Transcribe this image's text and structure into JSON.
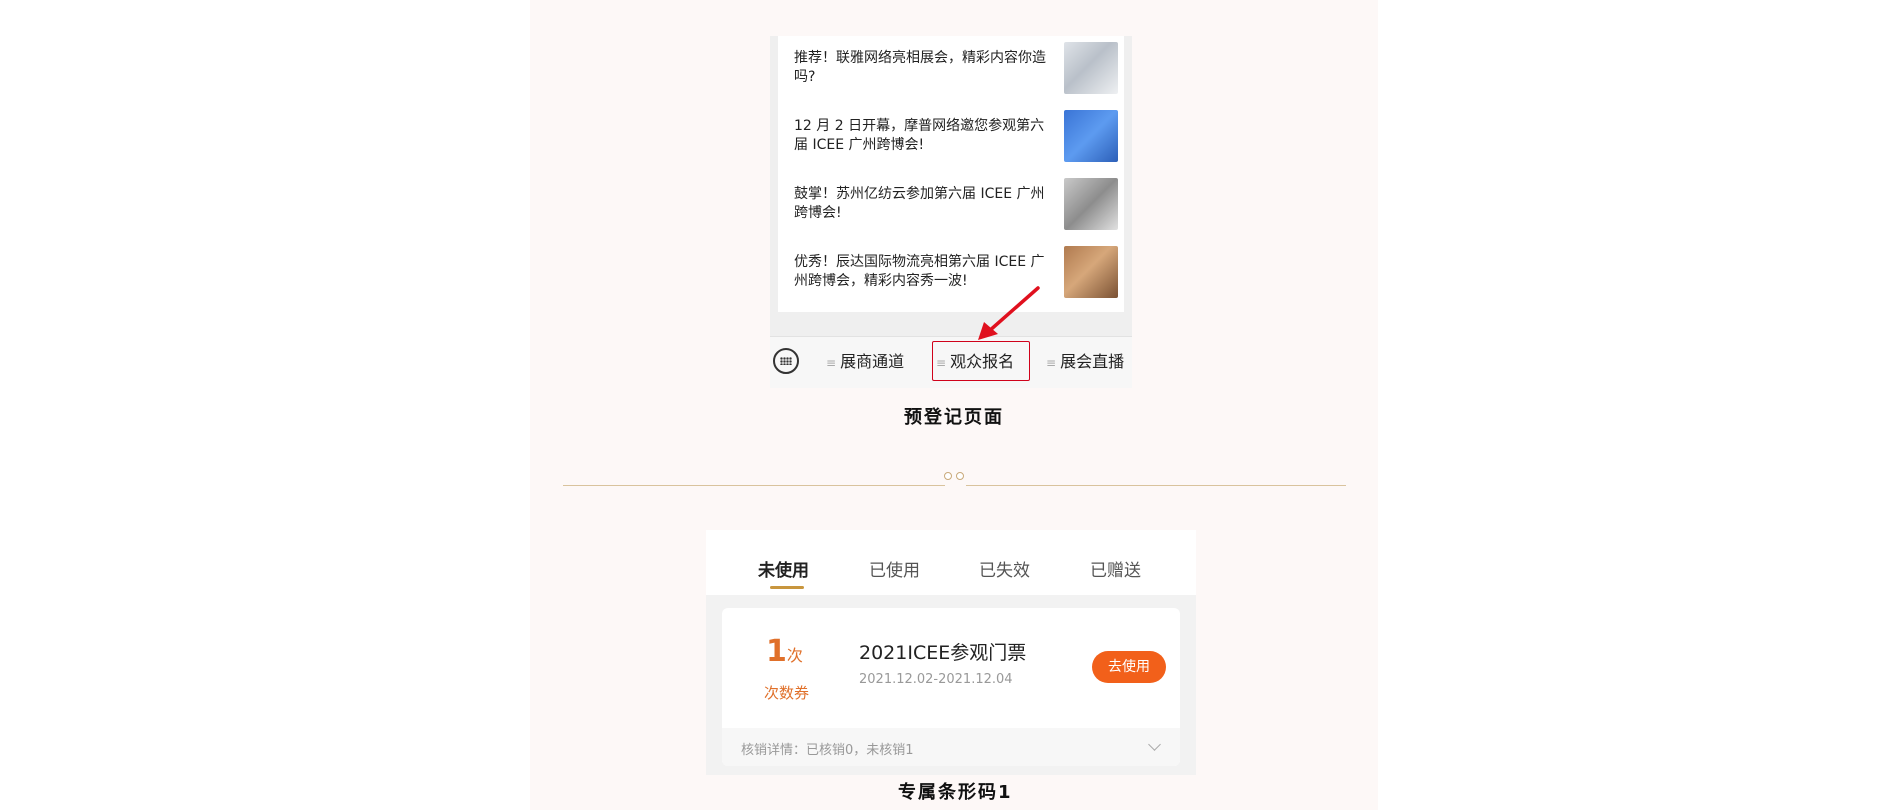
{
  "news": {
    "items": [
      {
        "title": "推荐！联雅网络亮相展会，精彩内容你造吗?"
      },
      {
        "title": "12 月 2 日开幕，摩普网络邀您参观第六届 ICEE 广州跨博会!"
      },
      {
        "title": "鼓掌！苏州亿纺云参加第六届 ICEE 广州跨博会!"
      },
      {
        "title": "优秀！辰达国际物流亮相第六届 ICEE 广州跨博会，精彩内容秀一波!"
      }
    ]
  },
  "bottom_menu": {
    "items": [
      {
        "label": "展商通道"
      },
      {
        "label": "观众报名"
      },
      {
        "label": "展会直播"
      }
    ],
    "highlighted": "观众报名"
  },
  "captions": {
    "pre_registration": "预登记页面",
    "exclusive_barcode": "专属条形码1"
  },
  "ticket_tabs": {
    "tabs": [
      {
        "label": "未使用",
        "active": true
      },
      {
        "label": "已使用",
        "active": false
      },
      {
        "label": "已失效",
        "active": false
      },
      {
        "label": "已赠送",
        "active": false
      }
    ]
  },
  "coupon": {
    "count": "1",
    "count_unit": "次",
    "type": "次数券",
    "title": "2021ICEE参观门票",
    "date_range": "2021.12.02-2021.12.04",
    "action_label": "去使用",
    "footer": "核销详情：已核销0，未核销1"
  },
  "colors": {
    "accent_orange": "#f2601a",
    "coupon_text_orange": "#e0702a",
    "highlight_red": "#d0021b",
    "tab_underline": "#c8963e",
    "divider_gold": "#d9c39d"
  }
}
